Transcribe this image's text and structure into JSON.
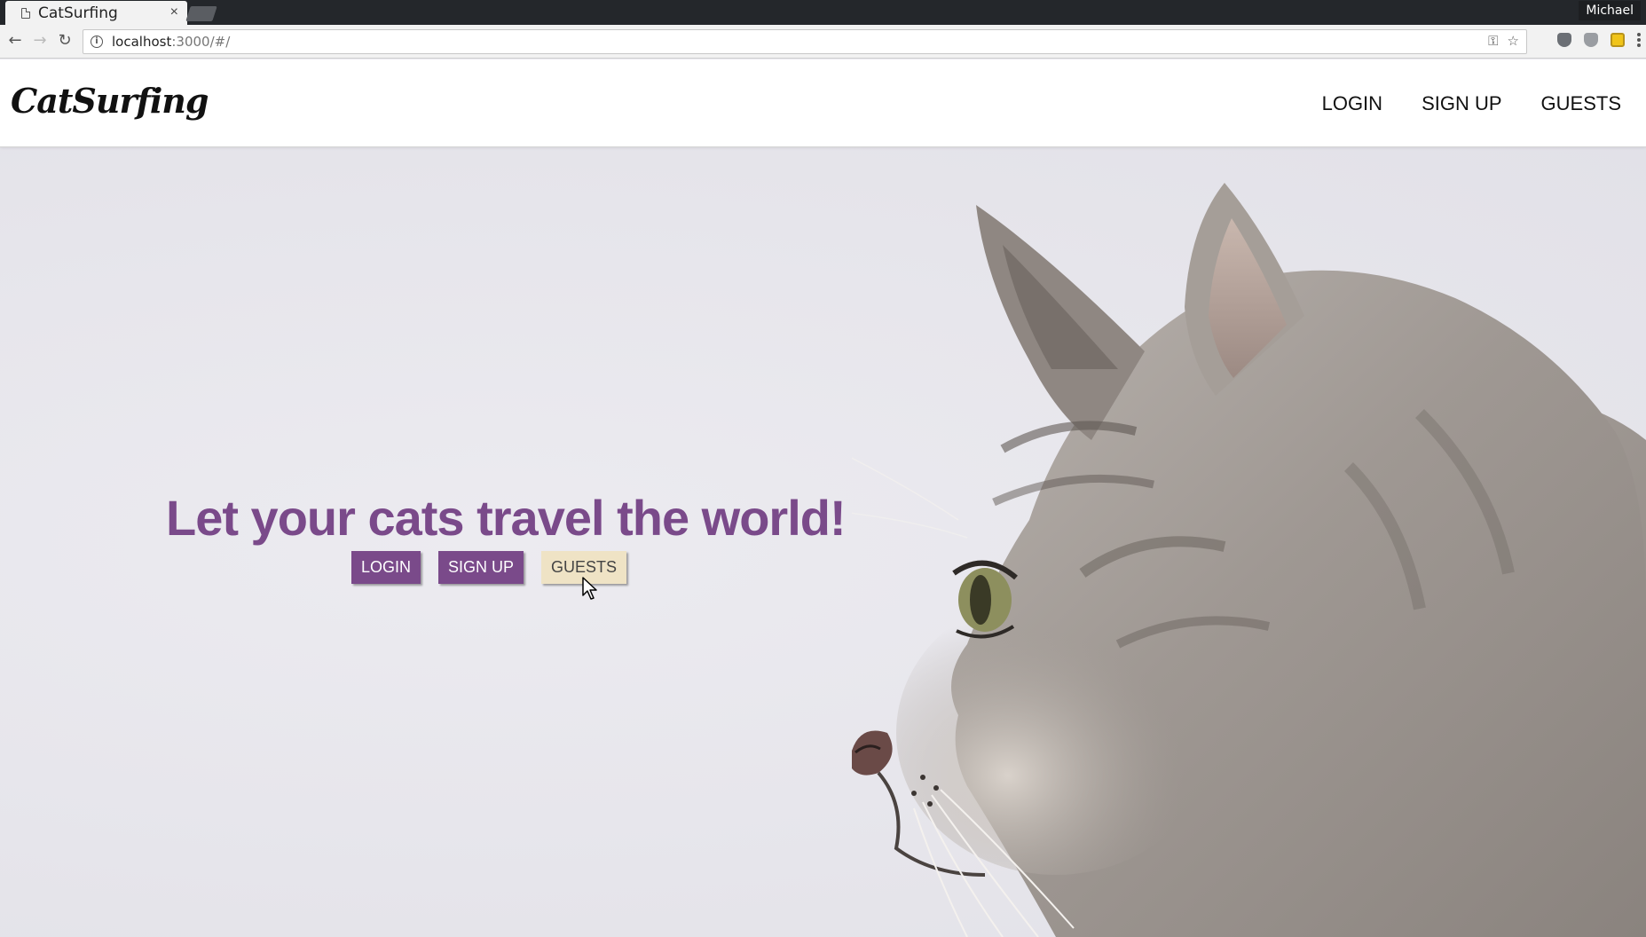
{
  "browser": {
    "tab_title": "CatSurfing",
    "tab_close": "×",
    "profile_name": "Michael",
    "url_host": "localhost",
    "url_path": ":3000/#/",
    "icons": [
      "page-icon",
      "close-icon",
      "back-icon",
      "forward-icon",
      "reload-icon",
      "info-icon",
      "key-icon",
      "star-icon",
      "extension-icon",
      "shield-icon",
      "notes-icon",
      "menu-icon"
    ]
  },
  "site": {
    "brand": "CatSurfing",
    "nav": {
      "login": "LOGIN",
      "signup": "SIGN UP",
      "guests": "GUESTS"
    }
  },
  "hero": {
    "title": "Let your cats travel the world!",
    "buttons": {
      "login": "LOGIN",
      "signup": "SIGN UP",
      "guests": "GUESTS"
    }
  },
  "colors": {
    "accent": "#7a4a8a",
    "guests_button": "#efe3c5",
    "background": "#e9e8ee"
  }
}
